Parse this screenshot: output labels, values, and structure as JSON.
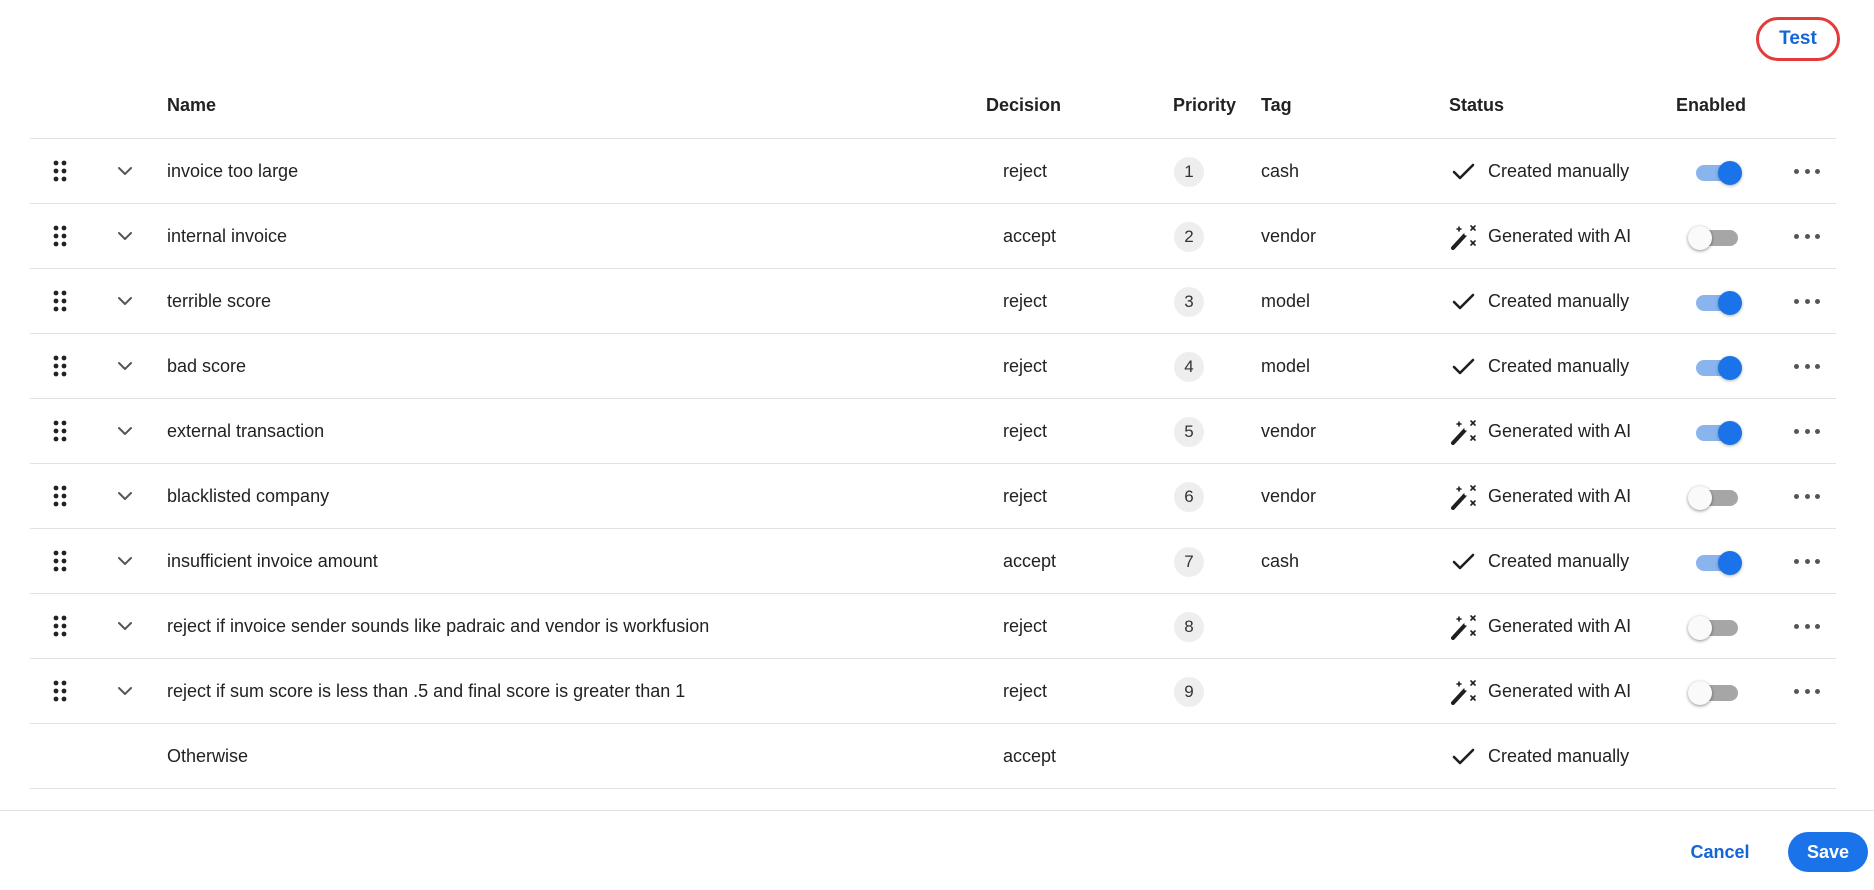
{
  "toolbar": {
    "test_label": "Test"
  },
  "columns": {
    "name": "Name",
    "decision": "Decision",
    "priority": "Priority",
    "tag": "Tag",
    "status": "Status",
    "enabled": "Enabled"
  },
  "rows": [
    {
      "name": "invoice too large",
      "decision": "reject",
      "priority": "1",
      "tag": "cash",
      "status": "Created manually",
      "status_icon": "check-icon",
      "enabled": true
    },
    {
      "name": "internal invoice",
      "decision": "accept",
      "priority": "2",
      "tag": "vendor",
      "status": "Generated with AI",
      "status_icon": "magic-wand-icon",
      "enabled": false
    },
    {
      "name": "terrible score",
      "decision": "reject",
      "priority": "3",
      "tag": "model",
      "status": "Created manually",
      "status_icon": "check-icon",
      "enabled": true
    },
    {
      "name": "bad score",
      "decision": "reject",
      "priority": "4",
      "tag": "model",
      "status": "Created manually",
      "status_icon": "check-icon",
      "enabled": true
    },
    {
      "name": "external transaction",
      "decision": "reject",
      "priority": "5",
      "tag": "vendor",
      "status": "Generated with AI",
      "status_icon": "magic-wand-icon",
      "enabled": true
    },
    {
      "name": "blacklisted company",
      "decision": "reject",
      "priority": "6",
      "tag": "vendor",
      "status": "Generated with AI",
      "status_icon": "magic-wand-icon",
      "enabled": false
    },
    {
      "name": "insufficient invoice amount",
      "decision": "accept",
      "priority": "7",
      "tag": "cash",
      "status": "Created manually",
      "status_icon": "check-icon",
      "enabled": true
    },
    {
      "name": "reject if invoice sender sounds like padraic and vendor is workfusion",
      "decision": "reject",
      "priority": "8",
      "tag": "",
      "status": "Generated with AI",
      "status_icon": "magic-wand-icon",
      "enabled": false
    },
    {
      "name": "reject if sum score is less than .5 and final score is greater than 1",
      "decision": "reject",
      "priority": "9",
      "tag": "",
      "status": "Generated with AI",
      "status_icon": "magic-wand-icon",
      "enabled": false
    }
  ],
  "otherwise": {
    "name": "Otherwise",
    "decision": "accept",
    "status": "Created manually",
    "status_icon": "check-icon"
  },
  "footer": {
    "cancel_label": "Cancel",
    "save_label": "Save"
  },
  "colors": {
    "accent": "#1a73e8",
    "link": "#1466d6",
    "highlight_ring": "#e53a3a",
    "toggle_off": "#a6a6a6"
  }
}
